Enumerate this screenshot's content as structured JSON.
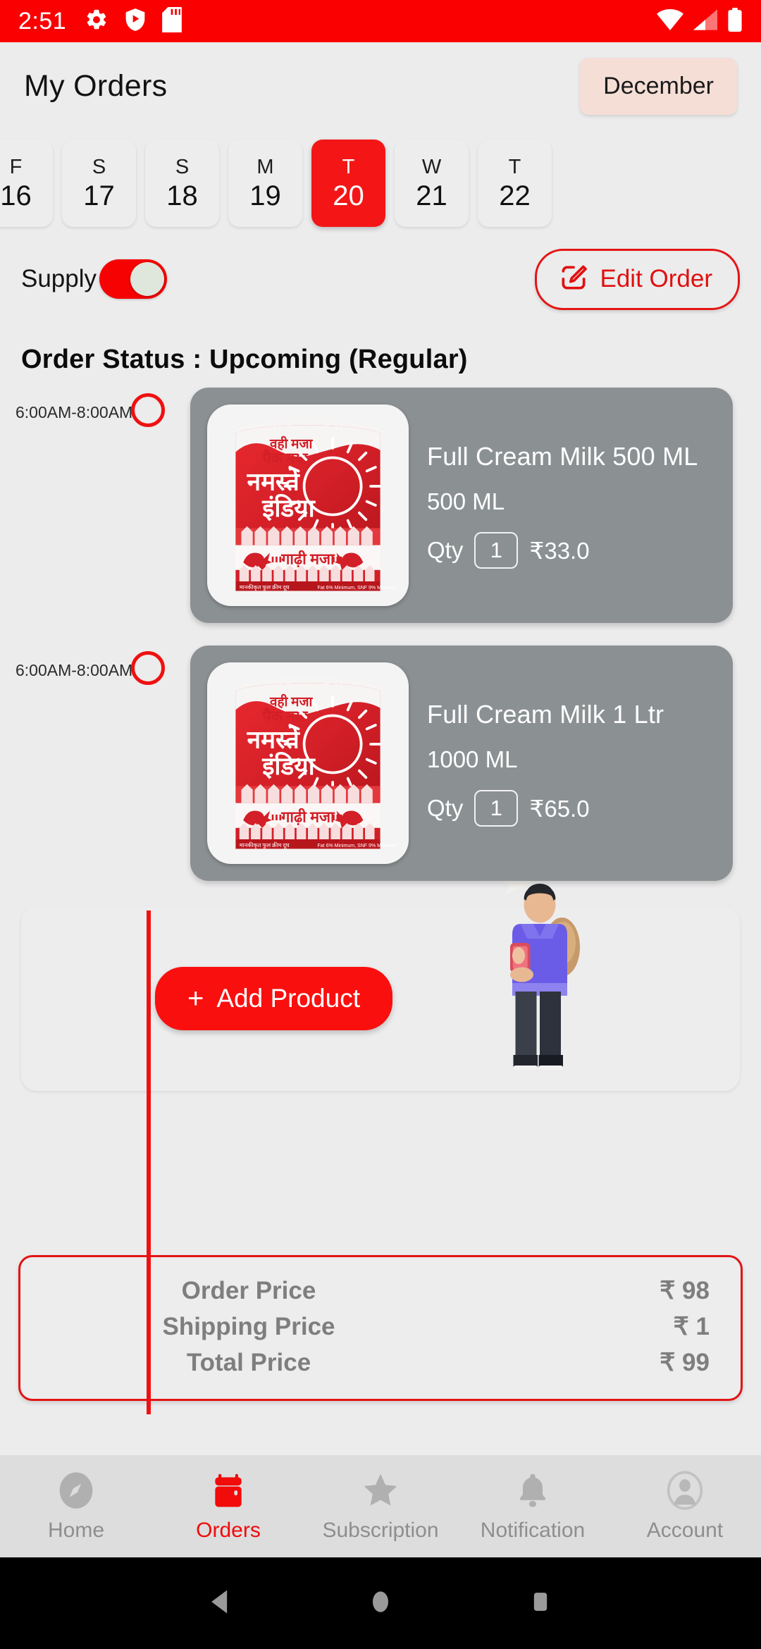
{
  "status_bar": {
    "time": "2:51",
    "left_icons": [
      "gear-icon",
      "shield-play-icon",
      "sd-card-icon"
    ],
    "right_icons": [
      "wifi-icon",
      "cellular-signal-icon",
      "battery-icon"
    ],
    "background_color": "#fb0000"
  },
  "header": {
    "title": "My Orders",
    "month_button": "December"
  },
  "date_strip": {
    "days": [
      {
        "dow": "F",
        "num": "16",
        "selected": false
      },
      {
        "dow": "S",
        "num": "17",
        "selected": false
      },
      {
        "dow": "S",
        "num": "18",
        "selected": false
      },
      {
        "dow": "M",
        "num": "19",
        "selected": false
      },
      {
        "dow": "T",
        "num": "20",
        "selected": true
      },
      {
        "dow": "W",
        "num": "21",
        "selected": false
      },
      {
        "dow": "T",
        "num": "22",
        "selected": false
      }
    ],
    "selected_color": "#f41616"
  },
  "supply": {
    "label": "Supply",
    "toggle_on": true,
    "edit_button": "Edit Order"
  },
  "order": {
    "status_heading": "Order Status : Upcoming (Regular)",
    "items": [
      {
        "slot": "6:00AM-8:00AM",
        "name": "Full Cream Milk 500 ML",
        "volume": "500 ML",
        "qty_label": "Qty",
        "qty": "1",
        "price": "₹33.0"
      },
      {
        "slot": "6:00AM-8:00AM",
        "name": "Full Cream Milk 1 Ltr",
        "volume": "1000 ML",
        "qty_label": "Qty",
        "qty": "1",
        "price": "₹65.0"
      }
    ]
  },
  "add_product": {
    "plus": "+",
    "label": "Add Product"
  },
  "price_summary": {
    "rows": [
      {
        "label": "Order Price",
        "value": "₹ 98"
      },
      {
        "label": "Shipping Price",
        "value": "₹ 1"
      },
      {
        "label": "Total Price",
        "value": "₹ 99"
      }
    ],
    "border_color": "#e21414"
  },
  "bottom_nav": {
    "items": [
      {
        "label": "Home",
        "icon": "compass-icon",
        "active": false
      },
      {
        "label": "Orders",
        "icon": "calendar-icon",
        "active": true
      },
      {
        "label": "Subscription",
        "icon": "star-icon",
        "active": false
      },
      {
        "label": "Notification",
        "icon": "bell-icon",
        "active": false
      },
      {
        "label": "Account",
        "icon": "person-icon",
        "active": false
      }
    ],
    "active_color": "#f20b0b"
  },
  "android_nav": {
    "buttons": [
      "back-icon",
      "home-icon",
      "recents-icon"
    ]
  }
}
